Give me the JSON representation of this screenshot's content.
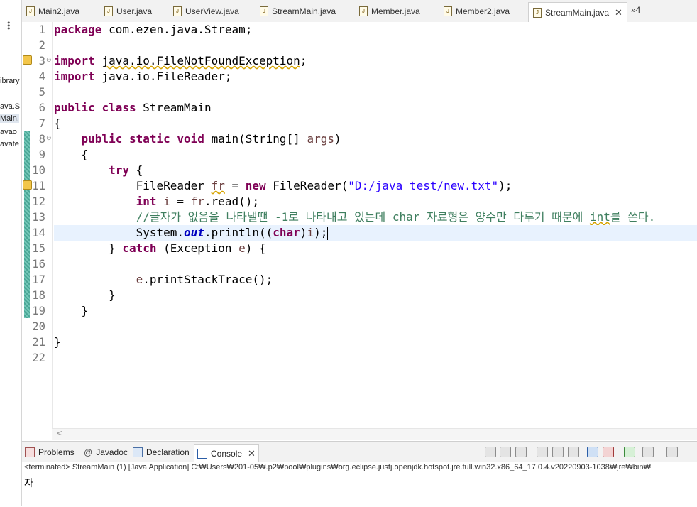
{
  "explorer": {
    "labels": [
      "ibrary",
      "ava.S",
      "Main.",
      "avao",
      "avate"
    ]
  },
  "tabs": [
    {
      "label": "Main2.java"
    },
    {
      "label": "User.java"
    },
    {
      "label": "UserView.java"
    },
    {
      "label": "StreamMain.java"
    },
    {
      "label": "Member.java"
    },
    {
      "label": "Member2.java"
    },
    {
      "label": "StreamMain.java",
      "active": true,
      "close": "✕"
    }
  ],
  "overflow_label": "»4",
  "editor": {
    "line_numbers": [
      "1",
      "2",
      "3",
      "4",
      "5",
      "6",
      "7",
      "8",
      "9",
      "10",
      "11",
      "12",
      "13",
      "14",
      "15",
      "16",
      "17",
      "18",
      "19",
      "20",
      "21",
      "22"
    ],
    "lines": {
      "l1": {
        "kw": "package",
        "rest": " com.ezen.java.Stream;"
      },
      "l3": {
        "kw": "import",
        "sp": " ",
        "warn": "java.io.FileNotFoundException",
        "end": ";"
      },
      "l4": {
        "kw": "import",
        "rest": " java.io.FileReader;"
      },
      "l6": {
        "kw1": "public",
        "kw2": "class",
        "rest": " StreamMain"
      },
      "l7": {
        "rest": "{"
      },
      "l8": {
        "indent": "    ",
        "kw1": "public",
        "kw2": "static",
        "kw3": "void",
        "rest": " main(String[] ",
        "var": "args",
        "end": ")"
      },
      "l9": {
        "rest": "    {"
      },
      "l10": {
        "indent": "        ",
        "kw": "try",
        "rest": " {"
      },
      "l11": {
        "indent": "            ",
        "pre": "FileReader ",
        "var": "fr",
        "mid": " = ",
        "kw": "new",
        "post": " FileReader(",
        "str": "\"D:/java_test/new.txt\"",
        "end": ");"
      },
      "l12": {
        "indent": "            ",
        "kw": "int",
        "sp": " ",
        "var": "i",
        "mid": " = ",
        "var2": "fr",
        "end": ".read();"
      },
      "l13": {
        "indent": "            ",
        "cmt1": "//글자가 없음을 나타낼땐 -1로 나타내고 있는데 char 자료형은 양수만 다루기 때문에 ",
        "cmt_warn": "int",
        "cmt2": "를 쓴다."
      },
      "l14": {
        "indent": "            ",
        "pre": "System.",
        "fld": "out",
        "mid": ".println((",
        "kw": "char",
        "end1": ")",
        "var": "i",
        "end2": ");"
      },
      "l15": {
        "indent": "        ",
        "pre": "} ",
        "kw": "catch",
        "mid": " (Exception ",
        "var": "e",
        "end": ") {"
      },
      "l17": {
        "indent": "            ",
        "var": "e",
        "end": ".printStackTrace();"
      },
      "l18": {
        "rest": "        }"
      },
      "l19": {
        "rest": "    }"
      },
      "l21": {
        "rest": "}"
      }
    },
    "scroll_arrow": "<"
  },
  "bottom_panel": {
    "tabs": [
      {
        "label": "Problems"
      },
      {
        "label": "Javadoc",
        "icon": "@"
      },
      {
        "label": "Declaration"
      },
      {
        "label": "Console",
        "active": true,
        "close": "✕"
      }
    ],
    "status": "<terminated> StreamMain (1) [Java Application] C:₩Users₩201-05₩.p2₩pool₩plugins₩org.eclipse.justj.openjdk.hotspot.jre.full.win32.x86_64_17.0.4.v20220903-1038₩jre₩bin₩",
    "output": "자"
  },
  "colors": {
    "keyword": "#7f0055",
    "string": "#2a00ff",
    "comment": "#3f7f5f",
    "field": "#0000c0",
    "local_var": "#6a3e3e",
    "current_line": "#e8f2fe"
  }
}
